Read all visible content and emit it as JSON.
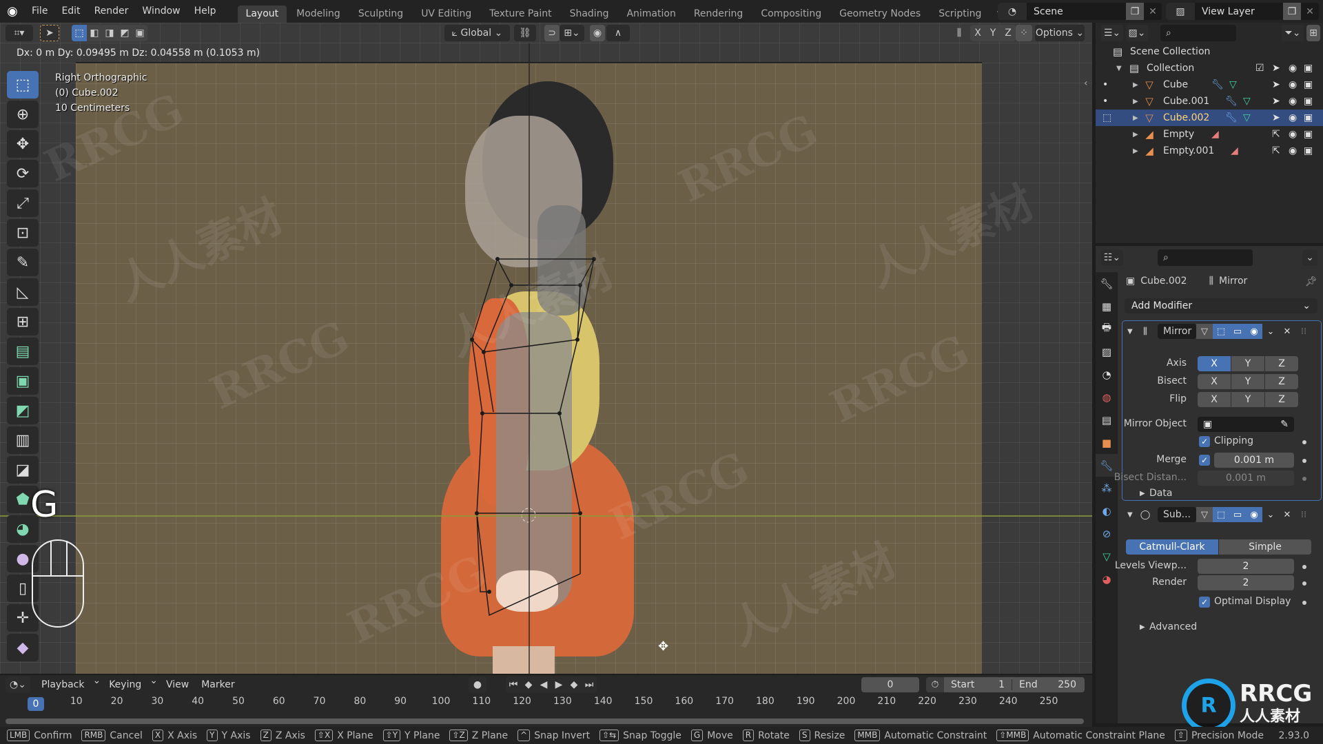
{
  "app": {
    "name": "Blender",
    "version": "2.93.0"
  },
  "menu": [
    "File",
    "Edit",
    "Render",
    "Window",
    "Help"
  ],
  "workspaces": [
    {
      "label": "Layout",
      "active": true
    },
    {
      "label": "Modeling"
    },
    {
      "label": "Sculpting"
    },
    {
      "label": "UV Editing"
    },
    {
      "label": "Texture Paint"
    },
    {
      "label": "Shading"
    },
    {
      "label": "Animation"
    },
    {
      "label": "Rendering"
    },
    {
      "label": "Compositing"
    },
    {
      "label": "Geometry Nodes"
    },
    {
      "label": "Scripting"
    }
  ],
  "add_workspace": "+",
  "scene": {
    "name": "Scene"
  },
  "view_layer": {
    "name": "View Layer"
  },
  "viewport_header": {
    "orientation": "Global",
    "mirror_axes": [
      "X",
      "Y",
      "Z"
    ],
    "options_label": "Options"
  },
  "viewport": {
    "transform_status": "Dx: 0 m   Dy: 0.09495 m  Dz: 0.04558 m (0.1053 m)",
    "view_name": "Right Orthographic",
    "object_info": "(0) Cube.002",
    "scale_info": "10 Centimeters",
    "key_overlay": "G"
  },
  "toolbar": [
    {
      "name": "select-box",
      "glyph": "⬚",
      "active": true
    },
    {
      "name": "cursor",
      "glyph": "⊕"
    },
    {
      "name": "move",
      "glyph": "✥"
    },
    {
      "name": "rotate",
      "glyph": "⟳"
    },
    {
      "name": "scale",
      "glyph": "⤢"
    },
    {
      "name": "transform",
      "glyph": "⊡"
    },
    {
      "name": "annotate",
      "glyph": "✎"
    },
    {
      "name": "measure",
      "glyph": "◺"
    },
    {
      "name": "add-cube",
      "glyph": "⊞"
    },
    {
      "name": "extrude",
      "glyph": "▤",
      "color": "green"
    },
    {
      "name": "inset",
      "glyph": "▣",
      "color": "green"
    },
    {
      "name": "bevel",
      "glyph": "◩",
      "color": "green"
    },
    {
      "name": "loop-cut",
      "glyph": "▥"
    },
    {
      "name": "knife",
      "glyph": "◪"
    },
    {
      "name": "poly-build",
      "glyph": "⬟",
      "color": "green"
    },
    {
      "name": "spin",
      "glyph": "◕",
      "color": "green"
    },
    {
      "name": "smooth",
      "glyph": "●",
      "color": "purple"
    },
    {
      "name": "edge-slide",
      "glyph": "▯"
    },
    {
      "name": "shrink-fatten",
      "glyph": "✛"
    },
    {
      "name": "shear",
      "glyph": "◆",
      "color": "purple"
    }
  ],
  "outliner": {
    "root": "Scene Collection",
    "collection": "Collection",
    "items": [
      {
        "name": "Cube",
        "type": "mesh",
        "has_modifier": true,
        "selected": false
      },
      {
        "name": "Cube.001",
        "type": "mesh",
        "has_modifier": true,
        "selected": false
      },
      {
        "name": "Cube.002",
        "type": "mesh",
        "has_modifier": true,
        "selected": true
      },
      {
        "name": "Empty",
        "type": "empty",
        "has_modifier": false,
        "selected": false
      },
      {
        "name": "Empty.001",
        "type": "empty",
        "has_modifier": false,
        "selected": false
      }
    ]
  },
  "properties": {
    "object_name": "Cube.002",
    "modifier_context": "Mirror",
    "add_modifier_label": "Add Modifier",
    "mirror": {
      "name": "Mirror",
      "axis_label": "Axis",
      "bisect_label": "Bisect",
      "flip_label": "Flip",
      "axis": {
        "X": true,
        "Y": false,
        "Z": false
      },
      "bisect": {
        "X": false,
        "Y": false,
        "Z": false
      },
      "flip": {
        "X": false,
        "Y": false,
        "Z": false
      },
      "mirror_object_label": "Mirror Object",
      "mirror_object_value": "",
      "clipping_label": "Clipping",
      "clipping": true,
      "merge_label": "Merge",
      "merge": true,
      "merge_value": "0.001 m",
      "bisect_distance_label": "Bisect Distan...",
      "bisect_distance_value": "0.001 m",
      "data_label": "Data"
    },
    "subsurf": {
      "name": "Sub...",
      "catmull_label": "Catmull-Clark",
      "simple_label": "Simple",
      "mode": "Catmull-Clark",
      "levels_viewport_label": "Levels Viewp...",
      "levels_viewport": "2",
      "render_label": "Render",
      "render_levels": "2",
      "optimal_display_label": "Optimal Display",
      "optimal_display": true,
      "advanced_label": "Advanced"
    }
  },
  "timeline": {
    "menus": [
      "Playback",
      "Keying",
      "View",
      "Marker"
    ],
    "current_frame": "0",
    "start_label": "Start",
    "start": "1",
    "end_label": "End",
    "end": "250",
    "ticks": [
      "0",
      "10",
      "20",
      "30",
      "40",
      "50",
      "60",
      "70",
      "80",
      "90",
      "100",
      "110",
      "120",
      "130",
      "140",
      "150",
      "160",
      "170",
      "180",
      "190",
      "200",
      "210",
      "220",
      "230",
      "240",
      "250"
    ]
  },
  "statusbar": [
    {
      "key": "LMB",
      "label": "Confirm"
    },
    {
      "key": "RMB",
      "label": "Cancel"
    },
    {
      "key": "X",
      "label": "X Axis"
    },
    {
      "key": "Y",
      "label": "Y Axis"
    },
    {
      "key": "Z",
      "label": "Z Axis"
    },
    {
      "key": "⇧X",
      "label": "X Plane"
    },
    {
      "key": "⇧Y",
      "label": "Y Plane"
    },
    {
      "key": "⇧Z",
      "label": "Z Plane"
    },
    {
      "key": "^",
      "label": "Snap Invert"
    },
    {
      "key": "⇧⇆",
      "label": "Snap Toggle"
    },
    {
      "key": "G",
      "label": "Move"
    },
    {
      "key": "R",
      "label": "Rotate"
    },
    {
      "key": "S",
      "label": "Resize"
    },
    {
      "key": "MMB",
      "label": "Automatic Constraint"
    },
    {
      "key": "⇧MMB",
      "label": "Automatic Constraint Plane"
    },
    {
      "key": "⇧",
      "label": "Precision Mode"
    }
  ],
  "watermark": {
    "brand": "RRCG",
    "brand_sub": "人人素材",
    "text": "人人素材"
  },
  "colors": {
    "accent": "#4772b3",
    "selected_row": "#334d80",
    "mesh_icon": "#e98f50",
    "modifier_icon": "#6fa8e8",
    "mesh_data_icon": "#3fd0a0"
  }
}
